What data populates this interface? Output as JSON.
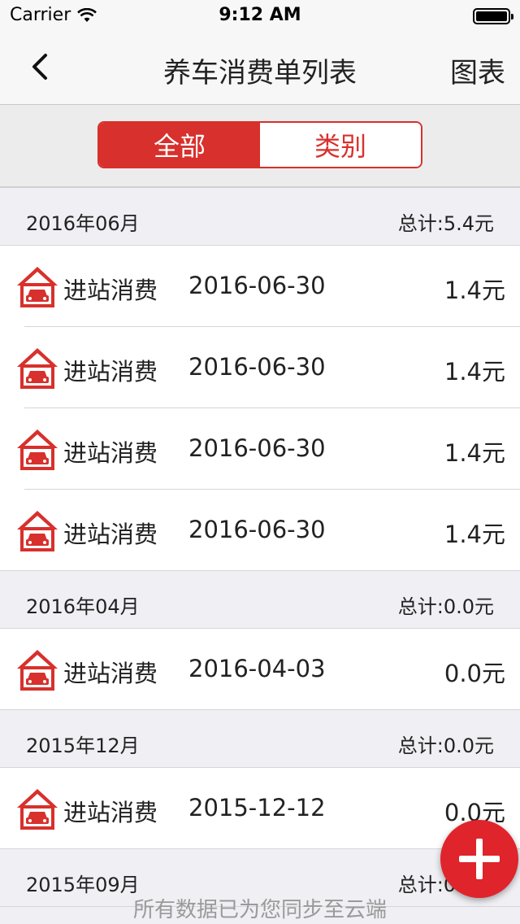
{
  "status_bar": {
    "carrier": "Carrier",
    "time": "9:12 AM"
  },
  "nav": {
    "title": "养车消费单列表",
    "chart_button": "图表"
  },
  "segments": {
    "all": "全部",
    "category": "类别"
  },
  "sections": [
    {
      "month": "2016年06月",
      "total": "总计:5.4元",
      "rows": [
        {
          "category": "进站消费",
          "date": "2016-06-30",
          "amount": "1.4元"
        },
        {
          "category": "进站消费",
          "date": "2016-06-30",
          "amount": "1.4元"
        },
        {
          "category": "进站消费",
          "date": "2016-06-30",
          "amount": "1.4元"
        },
        {
          "category": "进站消费",
          "date": "2016-06-30",
          "amount": "1.4元"
        }
      ]
    },
    {
      "month": "2016年04月",
      "total": "总计:0.0元",
      "rows": [
        {
          "category": "进站消费",
          "date": "2016-04-03",
          "amount": "0.0元"
        }
      ]
    },
    {
      "month": "2015年12月",
      "total": "总计:0.0元",
      "rows": [
        {
          "category": "进站消费",
          "date": "2015-12-12",
          "amount": "0.0元"
        }
      ]
    },
    {
      "month": "2015年09月",
      "total": "总计:0.0元",
      "rows": []
    }
  ],
  "footer": {
    "sync_text": "所有数据已为您同步至云端"
  },
  "colors": {
    "accent": "#d8302c",
    "fab": "#e0242b"
  }
}
